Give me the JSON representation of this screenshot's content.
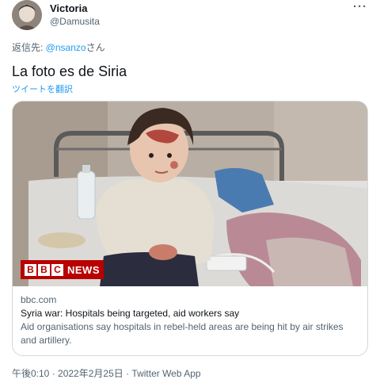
{
  "user": {
    "display_name": "Victoria",
    "handle": "@Damusita",
    "avatar_icon": "avatar-photo"
  },
  "more_label": "···",
  "reply": {
    "prefix": "返信先: ",
    "mention": "@nsanzo",
    "suffix": "さん"
  },
  "tweet": {
    "text": "La foto es de Siria",
    "translate_label": "ツイートを翻訳"
  },
  "card": {
    "brand_left": "BBC",
    "brand_right": "NEWS",
    "domain": "bbc.com",
    "title": "Syria war: Hospitals being targeted, aid workers say",
    "description": "Aid organisations say hospitals in rebel-held areas are being hit by air strikes and artillery."
  },
  "footer": {
    "timestamp": "午後0:10 · 2022年2月25日 · Twitter Web App"
  },
  "colors": {
    "accent": "#1d9bf0",
    "muted": "#536471",
    "bbc_red": "#b80000"
  }
}
